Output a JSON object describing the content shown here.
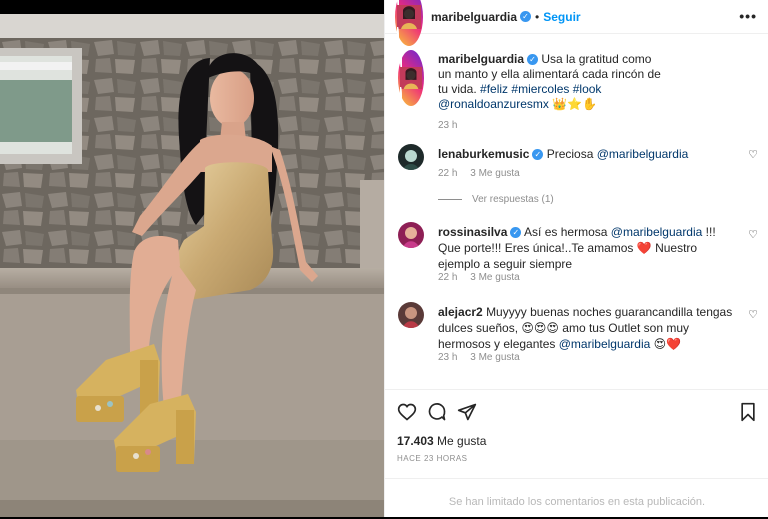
{
  "post": {
    "username": "maribelguardia",
    "follow_label": "Seguir",
    "more_label": "•••",
    "caption": {
      "text": "Usa la gratitud como un manto y ella alimentará cada rincón de tu vida.",
      "hashtags": "#feliz #miercoles #look",
      "mention": "@ronaldoanzuresmx",
      "emojis": "👑⭐✋",
      "time": "23 h"
    },
    "comments": [
      {
        "username": "lenaburkemusic",
        "verified": true,
        "text": "Preciosa",
        "mention": "@maribelguardia",
        "time": "22 h",
        "likes": "3 Me gusta",
        "view_replies": "Ver respuestas (1)"
      },
      {
        "username": "rossinasilva",
        "verified": true,
        "text_a": "Así es hermosa",
        "mention": "@maribelguardia",
        "text_b": "!!! Que porte!!! Eres única!..Te amamos",
        "heart": "❤️",
        "text_c": "Nuestro ejemplo a seguir siempre",
        "time": "22 h",
        "likes": "3 Me gusta"
      },
      {
        "username": "alejacr2",
        "verified": false,
        "text_a": "Muyyyy buenas noches guarancandilla tengas dulces sueños,",
        "emoji_a": "😍😍😍",
        "text_b": "amo tus Outlet son muy hermosos y elegantes",
        "mention": "@maribelguardia",
        "emoji_b": "😍❤️",
        "time": "23 h",
        "likes": "3 Me gusta"
      }
    ],
    "likes_count": "17.403",
    "likes_label": "Me gusta",
    "posted_ago": "HACE 23 HORAS",
    "comments_limited": "Se han limitado los comentarios en esta publicación."
  },
  "icons": {
    "like": "heart-outline-icon",
    "comment": "comment-icon",
    "share": "paper-plane-icon",
    "save": "bookmark-icon",
    "verified": "verified-badge-icon",
    "comment_like": "heart-outline-icon"
  },
  "colors": {
    "accent_blue": "#0095f6",
    "verified_blue": "#3897f0",
    "text": "#262626",
    "muted": "#8e8e8e",
    "link": "#00376b"
  }
}
